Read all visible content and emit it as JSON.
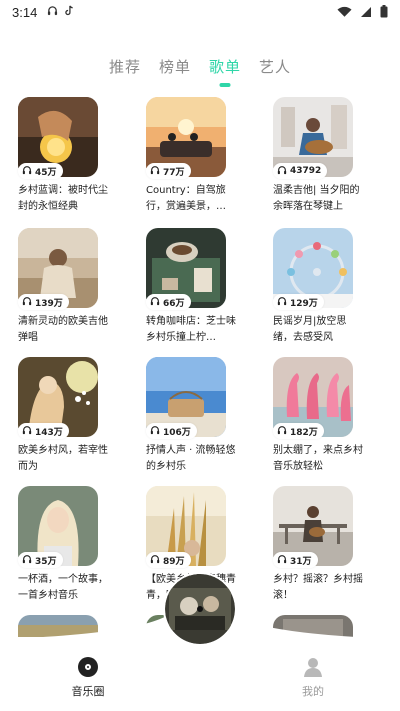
{
  "status_bar": {
    "time": "3:14",
    "left_icons": [
      "headphones-icon",
      "tiktok-icon"
    ],
    "right_icons": [
      "wifi-icon",
      "signal-icon",
      "battery-icon"
    ]
  },
  "tabs": [
    {
      "label": "推荐",
      "active": false
    },
    {
      "label": "榜单",
      "active": false
    },
    {
      "label": "歌单",
      "active": true
    },
    {
      "label": "艺人",
      "active": false
    }
  ],
  "playlists": [
    {
      "count": "45万",
      "title": "乡村蓝调：被时代尘封的永恒经典"
    },
    {
      "count": "77万",
      "title": "Country：自驾旅行，赏遍美景，…"
    },
    {
      "count": "43792",
      "title": "温柔吉他| 当夕阳的余晖落在琴键上"
    },
    {
      "count": "139万",
      "title": "清新灵动的欧美吉他弹唱"
    },
    {
      "count": "66万",
      "title": "转角咖啡店：芝士味乡村乐撞上柠…"
    },
    {
      "count": "129万",
      "title": "民谣岁月|放空思绪，去感受风"
    },
    {
      "count": "143万",
      "title": "欧美乡村风，若宰性而为"
    },
    {
      "count": "106万",
      "title": "抒情人声 · 流畅轻悠的乡村乐"
    },
    {
      "count": "182万",
      "title": "别太绷了，来点乡村音乐放轻松"
    },
    {
      "count": "35万",
      "title": "一杯酒，一个故事，一首乡村音乐"
    },
    {
      "count": "89万",
      "title": "【欧美乡村】麦穗青青，吹来一阵…"
    },
    {
      "count": "31万",
      "title": "乡村？摇滚？乡村摇滚！"
    }
  ],
  "bottom_nav": {
    "left_label": "音乐圈",
    "right_label": "我的"
  },
  "colors": {
    "accent": "#2fd6a8",
    "inactive_tab": "#8a8a8a"
  }
}
